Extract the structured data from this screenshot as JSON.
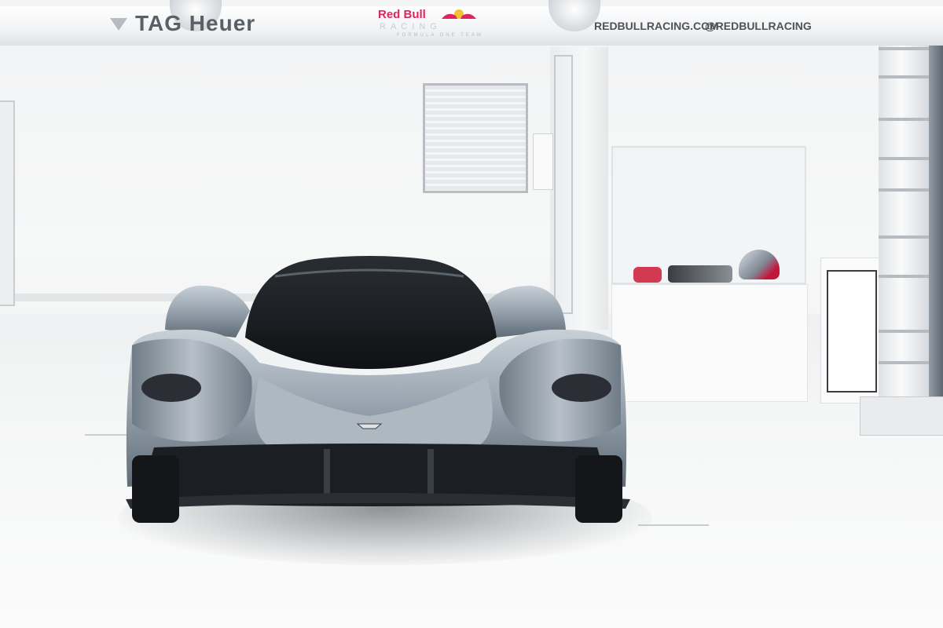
{
  "scene": {
    "gantry": {
      "tag_heuer_text": "TAG Heuer",
      "red_bull_word": "Red Bull",
      "racing_word": "RACING",
      "team_word": "FORMULA ONE TEAM",
      "website": "REDBULLRACING.COM",
      "social_handle": "@REDBULLRACING"
    },
    "colors": {
      "red_bull_pink": "#e0245e",
      "car_silver": "#9aa6b1",
      "car_dark": "#1b1e22",
      "wall": "#f2f3f4"
    },
    "icons": [
      "tag-heuer-shield-icon",
      "red-bull-bulls-icon",
      "aston-martin-wings-icon",
      "ceiling-lamp-icon"
    ]
  }
}
